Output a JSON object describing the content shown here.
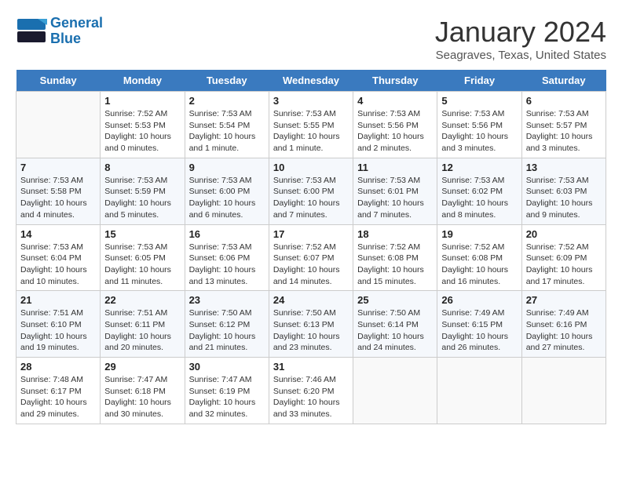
{
  "header": {
    "logo_line1": "General",
    "logo_line2": "Blue",
    "month": "January 2024",
    "location": "Seagraves, Texas, United States"
  },
  "days_of_week": [
    "Sunday",
    "Monday",
    "Tuesday",
    "Wednesday",
    "Thursday",
    "Friday",
    "Saturday"
  ],
  "weeks": [
    [
      {
        "num": "",
        "empty": true
      },
      {
        "num": "1",
        "sunrise": "7:52 AM",
        "sunset": "5:53 PM",
        "daylight": "10 hours and 0 minutes."
      },
      {
        "num": "2",
        "sunrise": "7:53 AM",
        "sunset": "5:54 PM",
        "daylight": "10 hours and 1 minute."
      },
      {
        "num": "3",
        "sunrise": "7:53 AM",
        "sunset": "5:55 PM",
        "daylight": "10 hours and 1 minute."
      },
      {
        "num": "4",
        "sunrise": "7:53 AM",
        "sunset": "5:56 PM",
        "daylight": "10 hours and 2 minutes."
      },
      {
        "num": "5",
        "sunrise": "7:53 AM",
        "sunset": "5:56 PM",
        "daylight": "10 hours and 3 minutes."
      },
      {
        "num": "6",
        "sunrise": "7:53 AM",
        "sunset": "5:57 PM",
        "daylight": "10 hours and 3 minutes."
      }
    ],
    [
      {
        "num": "7",
        "sunrise": "7:53 AM",
        "sunset": "5:58 PM",
        "daylight": "10 hours and 4 minutes."
      },
      {
        "num": "8",
        "sunrise": "7:53 AM",
        "sunset": "5:59 PM",
        "daylight": "10 hours and 5 minutes."
      },
      {
        "num": "9",
        "sunrise": "7:53 AM",
        "sunset": "6:00 PM",
        "daylight": "10 hours and 6 minutes."
      },
      {
        "num": "10",
        "sunrise": "7:53 AM",
        "sunset": "6:00 PM",
        "daylight": "10 hours and 7 minutes."
      },
      {
        "num": "11",
        "sunrise": "7:53 AM",
        "sunset": "6:01 PM",
        "daylight": "10 hours and 7 minutes."
      },
      {
        "num": "12",
        "sunrise": "7:53 AM",
        "sunset": "6:02 PM",
        "daylight": "10 hours and 8 minutes."
      },
      {
        "num": "13",
        "sunrise": "7:53 AM",
        "sunset": "6:03 PM",
        "daylight": "10 hours and 9 minutes."
      }
    ],
    [
      {
        "num": "14",
        "sunrise": "7:53 AM",
        "sunset": "6:04 PM",
        "daylight": "10 hours and 10 minutes."
      },
      {
        "num": "15",
        "sunrise": "7:53 AM",
        "sunset": "6:05 PM",
        "daylight": "10 hours and 11 minutes."
      },
      {
        "num": "16",
        "sunrise": "7:53 AM",
        "sunset": "6:06 PM",
        "daylight": "10 hours and 13 minutes."
      },
      {
        "num": "17",
        "sunrise": "7:52 AM",
        "sunset": "6:07 PM",
        "daylight": "10 hours and 14 minutes."
      },
      {
        "num": "18",
        "sunrise": "7:52 AM",
        "sunset": "6:08 PM",
        "daylight": "10 hours and 15 minutes."
      },
      {
        "num": "19",
        "sunrise": "7:52 AM",
        "sunset": "6:08 PM",
        "daylight": "10 hours and 16 minutes."
      },
      {
        "num": "20",
        "sunrise": "7:52 AM",
        "sunset": "6:09 PM",
        "daylight": "10 hours and 17 minutes."
      }
    ],
    [
      {
        "num": "21",
        "sunrise": "7:51 AM",
        "sunset": "6:10 PM",
        "daylight": "10 hours and 19 minutes."
      },
      {
        "num": "22",
        "sunrise": "7:51 AM",
        "sunset": "6:11 PM",
        "daylight": "10 hours and 20 minutes."
      },
      {
        "num": "23",
        "sunrise": "7:50 AM",
        "sunset": "6:12 PM",
        "daylight": "10 hours and 21 minutes."
      },
      {
        "num": "24",
        "sunrise": "7:50 AM",
        "sunset": "6:13 PM",
        "daylight": "10 hours and 23 minutes."
      },
      {
        "num": "25",
        "sunrise": "7:50 AM",
        "sunset": "6:14 PM",
        "daylight": "10 hours and 24 minutes."
      },
      {
        "num": "26",
        "sunrise": "7:49 AM",
        "sunset": "6:15 PM",
        "daylight": "10 hours and 26 minutes."
      },
      {
        "num": "27",
        "sunrise": "7:49 AM",
        "sunset": "6:16 PM",
        "daylight": "10 hours and 27 minutes."
      }
    ],
    [
      {
        "num": "28",
        "sunrise": "7:48 AM",
        "sunset": "6:17 PM",
        "daylight": "10 hours and 29 minutes."
      },
      {
        "num": "29",
        "sunrise": "7:47 AM",
        "sunset": "6:18 PM",
        "daylight": "10 hours and 30 minutes."
      },
      {
        "num": "30",
        "sunrise": "7:47 AM",
        "sunset": "6:19 PM",
        "daylight": "10 hours and 32 minutes."
      },
      {
        "num": "31",
        "sunrise": "7:46 AM",
        "sunset": "6:20 PM",
        "daylight": "10 hours and 33 minutes."
      },
      {
        "num": "",
        "empty": true
      },
      {
        "num": "",
        "empty": true
      },
      {
        "num": "",
        "empty": true
      }
    ]
  ],
  "labels": {
    "sunrise_prefix": "Sunrise: ",
    "sunset_prefix": "Sunset: ",
    "daylight_prefix": "Daylight: "
  }
}
